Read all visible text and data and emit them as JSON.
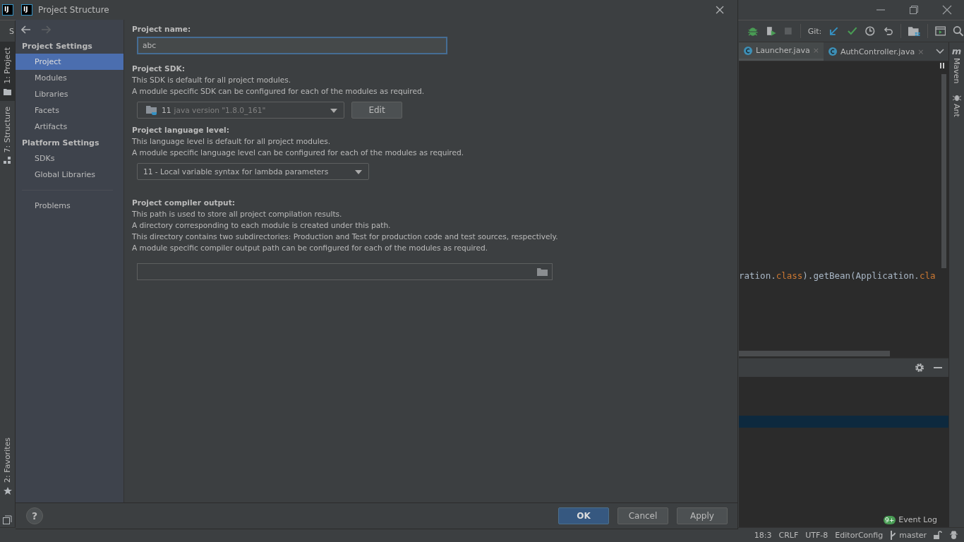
{
  "ide_logo_text": "IJ",
  "dialog_logo_text": "IJ",
  "ide": {
    "toolbar_text": "S",
    "git_label": "Git:",
    "tab_close": "×",
    "maven_glyph": "m",
    "left_tool_windows": [
      {
        "label": "1: Project",
        "selected": true
      },
      {
        "label": "7: Structure",
        "selected": false
      },
      {
        "label": "2: Favorites",
        "selected": false
      }
    ],
    "editor_tabs": [
      {
        "label": "Launcher.java",
        "selected": true
      },
      {
        "label": "AuthController.java",
        "selected": false
      }
    ],
    "code_tokens": [
      {
        "text": "ration.",
        "kind": "plain"
      },
      {
        "text": "class",
        "kind": "keyword"
      },
      {
        "text": ").getBean(Application.",
        "kind": "plain"
      },
      {
        "text": "cla",
        "kind": "keyword"
      }
    ],
    "right_tool_windows": [
      "Maven",
      "Ant"
    ],
    "event_log": {
      "badge": "9+",
      "label": "Event Log"
    },
    "status_items": [
      "18:3",
      "CRLF",
      "UTF-8",
      "EditorConfig"
    ],
    "branch": "master"
  },
  "dialog": {
    "title": "Project Structure",
    "sidebar": [
      {
        "heading": "Project Settings",
        "items": [
          {
            "label": "Project",
            "selected": true
          },
          {
            "label": "Modules",
            "selected": false
          },
          {
            "label": "Libraries",
            "selected": false
          },
          {
            "label": "Facets",
            "selected": false
          },
          {
            "label": "Artifacts",
            "selected": false
          }
        ]
      },
      {
        "heading": "Platform Settings",
        "items": [
          {
            "label": "SDKs",
            "selected": false
          },
          {
            "label": "Global Libraries",
            "selected": false
          }
        ]
      }
    ],
    "problems": "Problems",
    "help": "?",
    "sections": [
      {
        "title": "Project name:",
        "control": {
          "kind": "text",
          "value": "abc"
        }
      },
      {
        "title": "Project SDK:",
        "lines": [
          "This SDK is default for all project modules.",
          "A module specific SDK can be configured for each of the modules as required."
        ],
        "control": {
          "kind": "sdk",
          "version": "11",
          "detail": "java version \"1.8.0_161\"",
          "button": "Edit"
        }
      },
      {
        "title": "Project language level:",
        "lines": [
          "This language level is default for all project modules.",
          "A module specific language level can be configured for each of the modules as required."
        ],
        "control": {
          "kind": "select",
          "value": "11 - Local variable syntax for lambda parameters"
        }
      },
      {
        "title": "Project compiler output:",
        "lines": [
          "This path is used to store all project compilation results.",
          "A directory corresponding to each module is created under this path.",
          "This directory contains two subdirectories: Production and Test for production code and test sources, respectively.",
          "A module specific compiler output path can be configured for each of the modules as required."
        ],
        "control": {
          "kind": "path"
        }
      }
    ],
    "buttons": [
      {
        "label": "OK",
        "kind": "primary"
      },
      {
        "label": "Cancel",
        "kind": "normal"
      },
      {
        "label": "Apply",
        "kind": "normal"
      }
    ]
  }
}
